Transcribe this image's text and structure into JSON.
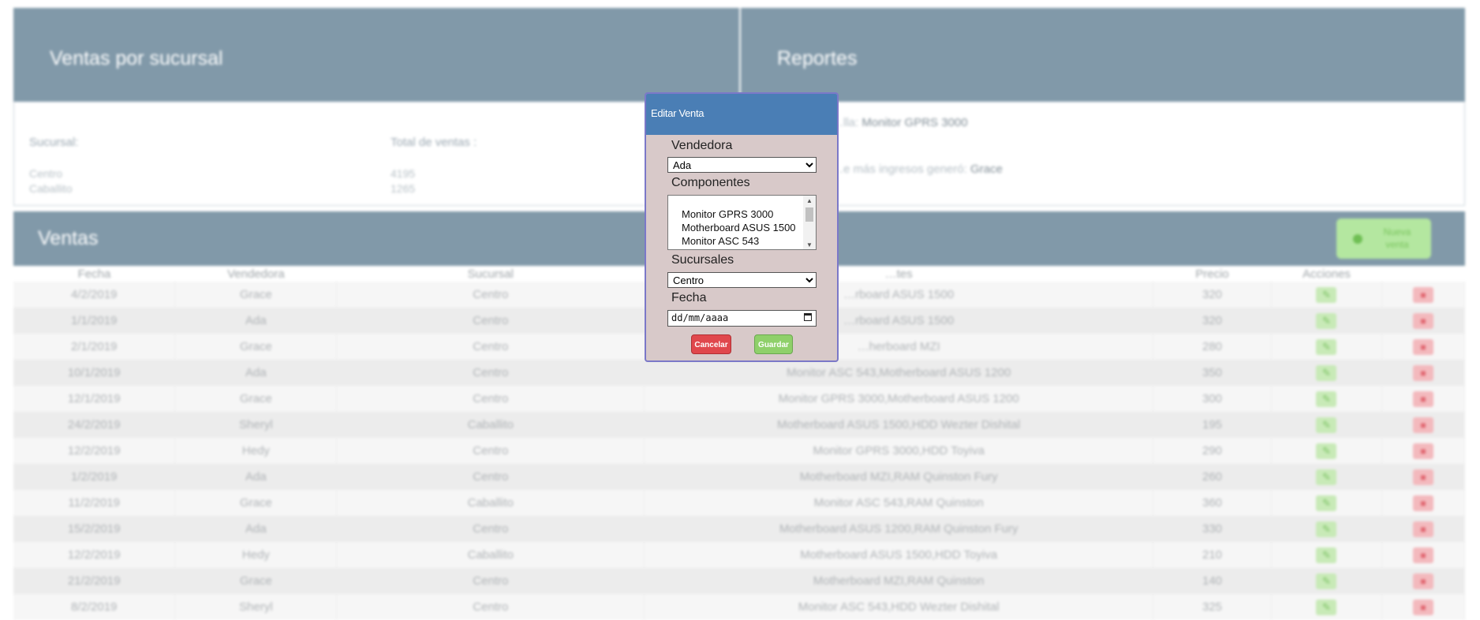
{
  "branch_panel": {
    "title": "Ventas por sucursal",
    "col_branch": "Sucursal:",
    "col_total": "Total de ventas :",
    "rows": [
      {
        "branch": "Centro",
        "total": "4195"
      },
      {
        "branch": "Caballito",
        "total": "1265"
      }
    ]
  },
  "reports_panel": {
    "title": "Reportes",
    "line1_prefix": "…lla:",
    "line1_value": "Monitor GPRS 3000",
    "line2_prefix": "…e más ingresos generó:",
    "line2_value": "Grace"
  },
  "sales": {
    "title": "Ventas",
    "new_button": "Nueva venta",
    "columns": [
      "Fecha",
      "Vendedora",
      "Sucursal",
      "…tes",
      "Precio",
      "Acciones",
      ""
    ],
    "rows": [
      {
        "date": "4/2/2019",
        "seller": "Grace",
        "branch": "Centro",
        "components": "…rboard ASUS 1500",
        "price": "320"
      },
      {
        "date": "1/1/2019",
        "seller": "Ada",
        "branch": "Centro",
        "components": "…rboard ASUS 1500",
        "price": "320"
      },
      {
        "date": "2/1/2019",
        "seller": "Grace",
        "branch": "Centro",
        "components": "…herboard MZI",
        "price": "280"
      },
      {
        "date": "10/1/2019",
        "seller": "Ada",
        "branch": "Centro",
        "components": "Monitor ASC 543,Motherboard ASUS 1200",
        "price": "350"
      },
      {
        "date": "12/1/2019",
        "seller": "Grace",
        "branch": "Centro",
        "components": "Monitor GPRS 3000,Motherboard ASUS 1200",
        "price": "300"
      },
      {
        "date": "24/2/2019",
        "seller": "Sheryl",
        "branch": "Caballito",
        "components": "Motherboard ASUS 1500,HDD Wezter Dishital",
        "price": "195"
      },
      {
        "date": "12/2/2019",
        "seller": "Hedy",
        "branch": "Centro",
        "components": "Monitor GPRS 3000,HDD Toyiva",
        "price": "290"
      },
      {
        "date": "1/2/2019",
        "seller": "Ada",
        "branch": "Centro",
        "components": "Motherboard MZI,RAM Quinston Fury",
        "price": "260"
      },
      {
        "date": "11/2/2019",
        "seller": "Grace",
        "branch": "Caballito",
        "components": "Monitor ASC 543,RAM Quinston",
        "price": "360"
      },
      {
        "date": "15/2/2019",
        "seller": "Ada",
        "branch": "Centro",
        "components": "Motherboard ASUS 1200,RAM Quinston Fury",
        "price": "330"
      },
      {
        "date": "12/2/2019",
        "seller": "Hedy",
        "branch": "Caballito",
        "components": "Motherboard ASUS 1500,HDD Toyiva",
        "price": "210"
      },
      {
        "date": "21/2/2019",
        "seller": "Grace",
        "branch": "Centro",
        "components": "Motherboard MZI,RAM Quinston",
        "price": "140"
      },
      {
        "date": "8/2/2019",
        "seller": "Sheryl",
        "branch": "Centro",
        "components": "Monitor ASC 543,HDD Wezter Dishital",
        "price": "325"
      }
    ],
    "edit_icon": "pencil-icon",
    "delete_icon": "trash-icon"
  },
  "modal": {
    "title": "Editar Venta",
    "seller_label": "Vendedora",
    "seller_value": "Ada",
    "components_label": "Componentes",
    "components_options": [
      "Monitor GPRS 3000",
      "Motherboard ASUS 1500",
      "Monitor ASC 543"
    ],
    "branch_label": "Sucursales",
    "branch_value": "Centro",
    "date_label": "Fecha",
    "date_placeholder": "dd/mm/aaaa",
    "cancel_label": "Cancelar",
    "save_label": "Guardar"
  },
  "colors": {
    "panel_header": "#8199a9",
    "modal_header": "#4a7eb5",
    "modal_body": "#d8c9c9",
    "cancel": "#e0474c",
    "save": "#8fd06a"
  }
}
